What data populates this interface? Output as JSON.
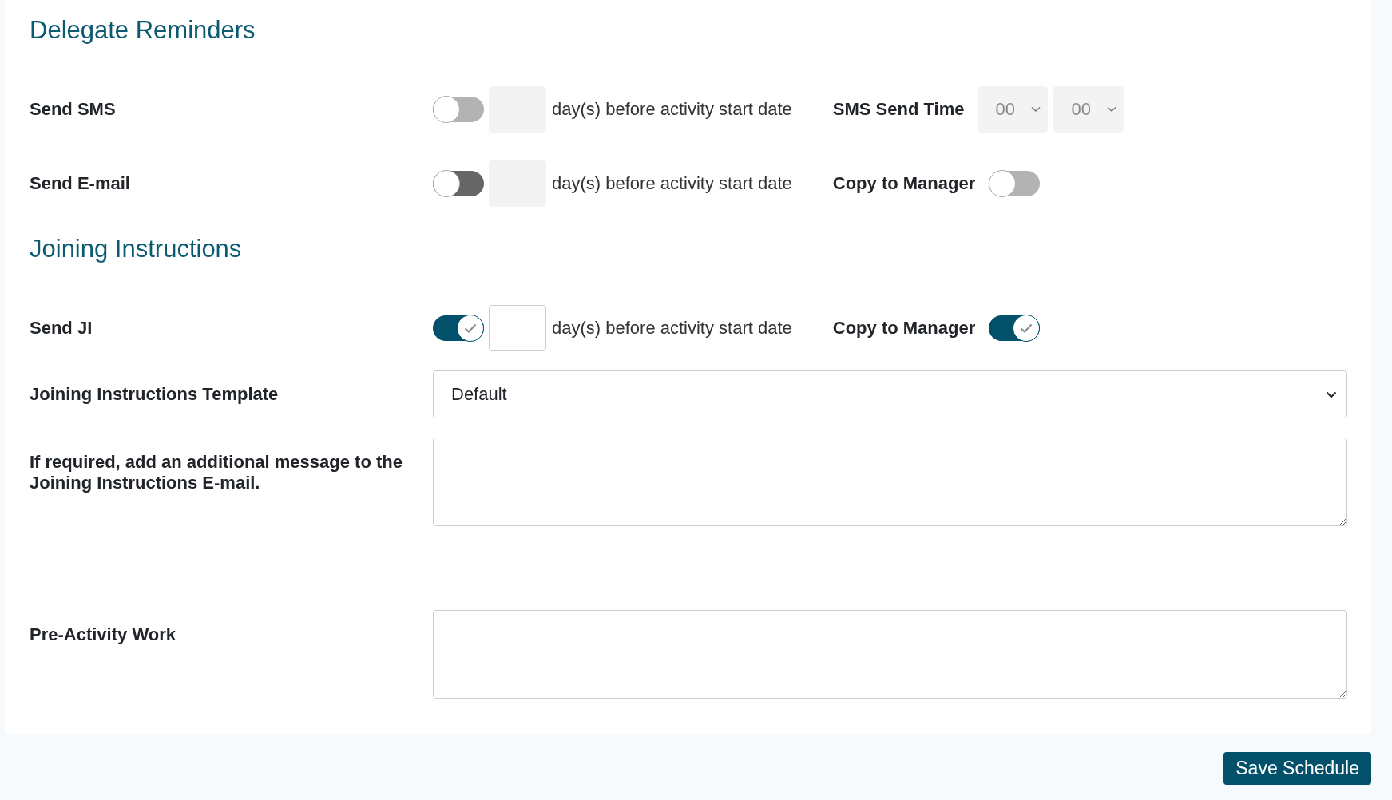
{
  "sections": [
    {
      "heading": "Delegate Reminders",
      "rows": [
        {
          "kind": "schedule",
          "label": "Send SMS",
          "toggle": {
            "on": false,
            "disabled": true
          },
          "days": {
            "disabled": true
          },
          "suffix": "day(s) before activity start date",
          "extra": {
            "kind": "time",
            "label": "SMS Send Time",
            "selects": [
              {
                "value": "00",
                "disabled": true
              },
              {
                "value": "00",
                "disabled": true
              }
            ]
          }
        },
        {
          "kind": "schedule",
          "label": "Send E-mail",
          "toggle": {
            "on": false,
            "disabled": false
          },
          "days": {
            "disabled": true
          },
          "suffix": "day(s) before activity start date",
          "extra": {
            "kind": "toggle",
            "label": "Copy to Manager",
            "toggle": {
              "on": false,
              "disabled": true
            }
          }
        }
      ]
    },
    {
      "heading": "Joining Instructions",
      "rows": [
        {
          "kind": "schedule",
          "label": "Send JI",
          "toggle": {
            "on": true,
            "disabled": false
          },
          "days": {
            "disabled": false
          },
          "suffix": "day(s) before activity start date",
          "extra": {
            "kind": "toggle",
            "label": "Copy to Manager",
            "toggle": {
              "on": true,
              "disabled": false
            }
          }
        },
        {
          "kind": "select",
          "label": "Joining Instructions Template",
          "value": "Default"
        },
        {
          "kind": "textarea",
          "label": "If required, add an additional message to the Joining Instructions E-mail."
        },
        {
          "kind": "textarea",
          "label": "Pre-Activity Work"
        }
      ]
    }
  ],
  "save_button": "Save Schedule"
}
